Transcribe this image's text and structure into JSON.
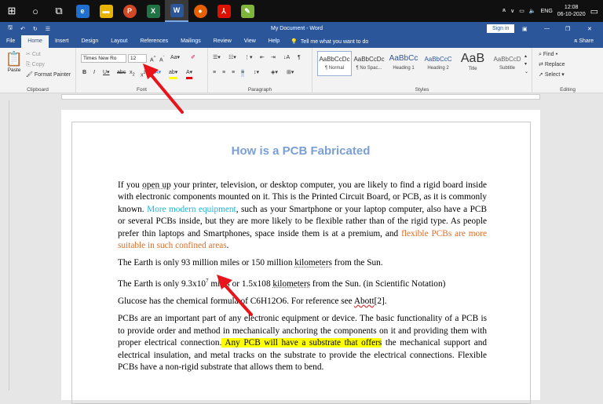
{
  "taskbar": {
    "time": "12:08",
    "date": "06-10-2020",
    "lang": "ENG"
  },
  "title": {
    "doc": "My Document - Word",
    "signin": "Sign in",
    "share": "Share"
  },
  "qat": {
    "file_tab": "File"
  },
  "tabs": [
    "Home",
    "Insert",
    "Design",
    "Layout",
    "References",
    "Mailings",
    "Review",
    "View",
    "Help"
  ],
  "tellme": "Tell me what you want to do",
  "clipboard": {
    "paste": "Paste",
    "cut": "Cut",
    "copy": "Copy",
    "painter": "Format Painter",
    "label": "Clipboard"
  },
  "font": {
    "name": "Times New Ro",
    "size": "12",
    "label": "Font"
  },
  "paragraph": {
    "label": "Paragraph"
  },
  "styles": {
    "label": "Styles",
    "items": [
      {
        "preview": "AaBbCcDc",
        "name": "¶ Normal"
      },
      {
        "preview": "AaBbCcDc",
        "name": "¶ No Spac..."
      },
      {
        "preview": "AaBbCc",
        "name": "Heading 1"
      },
      {
        "preview": "AaBbCcC",
        "name": "Heading 2"
      },
      {
        "preview": "AaB",
        "name": "Title"
      },
      {
        "preview": "AaBbCcD",
        "name": "Subtitle"
      }
    ]
  },
  "editing": {
    "find": "Find",
    "replace": "Replace",
    "select": "Select",
    "label": "Editing"
  },
  "document": {
    "title": "How is a PCB Fabricated",
    "p1_a": "If you ",
    "p1_u": "open up",
    "p1_b": " your printer, television, or desktop computer, you are likely to find a rigid board inside with electronic components mounted on it. This is the Printed Circuit Board, or PCB, as it is commonly known. ",
    "p1_blue": "More modern equipment",
    "p1_c": ", such as your Smartphone or your laptop computer, also have a PCB or several PCBs inside, but they are more likely to be flexible rather than of the rigid type. As people prefer thin laptops and Smartphones, space inside them is at a premium, and ",
    "p1_orange": "flexible PCBs are more suitable in such confined areas",
    "p1_d": ".",
    "p2_a": "The Earth is only 93 million miles or 150 million ",
    "p2_u": "kilometers",
    "p2_b": " from the Sun.",
    "p3_a": "The Earth is only 9.3x10",
    "p3_sup": "7",
    "p3_b": " miles or 1.5x108 ",
    "p3_u": "kilometers",
    "p3_c": " from the Sun. (in Scientific Notation)",
    "p4_a": "Glucose has the chemical formula of C6H12O6. For reference see ",
    "p4_u": "Abott",
    "p4_b": "[2].",
    "p5_a": "PCBs are an important part of any electronic equipment or device. The basic functionality of a PCB is to provide order and method in mechanically anchoring the components on it and providing them with proper electrical connection.",
    "p5_hl": " Any PCB will have a substrate that offers",
    "p5_b": " the mechanical support and electrical insulation, and metal tracks on the substrate to provide the electrical connections. Flexible PCBs have a non-rigid substrate that allows them to bend."
  },
  "colors": {
    "word_blue": "#2b579a",
    "title_blue": "#7a9fd4",
    "highlight": "#ffff00",
    "arrow_red": "#e8141c"
  }
}
